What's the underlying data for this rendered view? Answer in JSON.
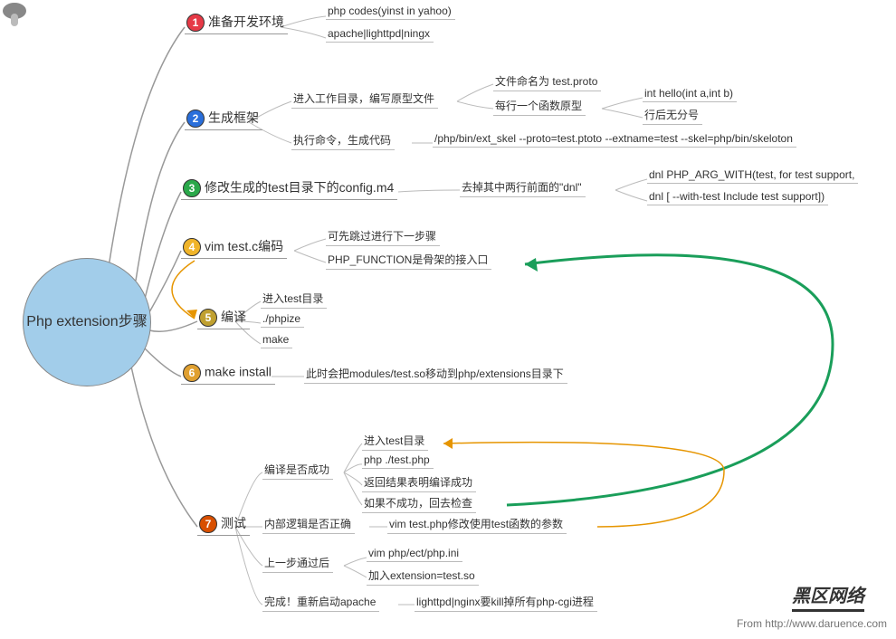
{
  "root_label": "Php extension步骤",
  "steps": [
    {
      "num": "1",
      "label": "准备开发环境",
      "children": [
        {
          "text": "php codes(yinst in yahoo)"
        },
        {
          "text": "apache|lighttpd|ningx"
        }
      ]
    },
    {
      "num": "2",
      "label": "生成框架",
      "children": [
        {
          "text": "进入工作目录，编写原型文件",
          "children": [
            {
              "text": "文件命名为 test.proto"
            },
            {
              "text": "每行一个函数原型",
              "children": [
                {
                  "text": "int hello(int a,int b)"
                },
                {
                  "text": "行后无分号"
                }
              ]
            }
          ]
        },
        {
          "text": "执行命令，生成代码",
          "children": [
            {
              "text": "/php/bin/ext_skel --proto=test.ptoto --extname=test --skel=php/bin/skeloton"
            }
          ]
        }
      ]
    },
    {
      "num": "3",
      "label": "修改生成的test目录下的config.m4",
      "children": [
        {
          "text": "去掉其中两行前面的\"dnl\"",
          "children": [
            {
              "text": "dnl PHP_ARG_WITH(test, for test support,"
            },
            {
              "text": "dnl [  --with-test             Include test support])"
            }
          ]
        }
      ]
    },
    {
      "num": "4",
      "label": "vim test.c编码",
      "children": [
        {
          "text": "可先跳过进行下一步骤"
        },
        {
          "text": "PHP_FUNCTION是骨架的接入口"
        }
      ]
    },
    {
      "num": "5",
      "label": "编译",
      "children": [
        {
          "text": "进入test目录"
        },
        {
          "text": "./phpize"
        },
        {
          "text": "make"
        }
      ]
    },
    {
      "num": "6",
      "label": "make install",
      "children": [
        {
          "text": "此时会把modules/test.so移动到php/extensions目录下"
        }
      ]
    },
    {
      "num": "7",
      "label": "测试",
      "children": [
        {
          "text": "编译是否成功",
          "children": [
            {
              "text": "进入test目录"
            },
            {
              "text": "php ./test.php"
            },
            {
              "text": "返回结果表明编译成功"
            },
            {
              "text": "如果不成功，回去检查"
            }
          ]
        },
        {
          "text": "内部逻辑是否正确",
          "children": [
            {
              "text": "vim test.php修改使用test函数的参数"
            }
          ]
        },
        {
          "text": "上一步通过后",
          "children": [
            {
              "text": "vim php/ect/php.ini"
            },
            {
              "text": "加入extension=test.so"
            }
          ]
        },
        {
          "text": "完成！重新启动apache",
          "children": [
            {
              "text": "lighttpd|nginx要kill掉所有php-cgi进程"
            }
          ]
        }
      ]
    }
  ],
  "footer_logo": "黑区网络",
  "footer_from": "From http://www.daruence.com"
}
